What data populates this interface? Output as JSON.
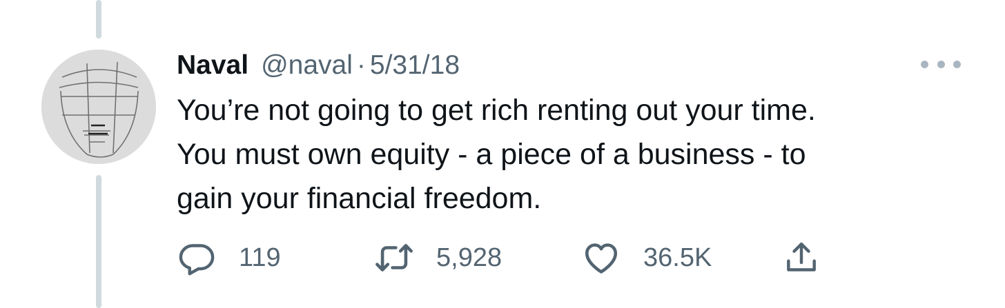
{
  "tweet": {
    "author_name": "Naval",
    "author_handle": "@naval",
    "separator": "·",
    "date": "5/31/18",
    "text_lines": [
      "You’re not going to get rich renting out your time.",
      "You must own equity - a piece of a business - to",
      "gain your financial freedom."
    ]
  },
  "actions": {
    "reply": {
      "icon": "reply-icon",
      "count": "119"
    },
    "retweet": {
      "icon": "retweet-icon",
      "count": "5,928"
    },
    "like": {
      "icon": "heart-icon",
      "count": "36.5K"
    },
    "share": {
      "icon": "share-icon"
    }
  },
  "colors": {
    "text_primary": "#0f1419",
    "text_secondary": "#536471",
    "thread_line": "#cfd9de",
    "more_dots": "#a9b6c1"
  }
}
